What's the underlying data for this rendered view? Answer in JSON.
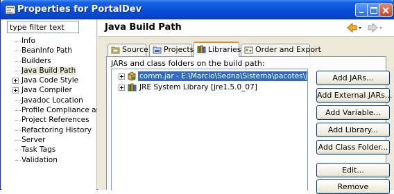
{
  "window": {
    "title": "Properties for PortalDev",
    "minimize_icon": "minimize-icon",
    "maximize_icon": "maximize-icon",
    "close_icon": "close-icon"
  },
  "filter": {
    "value": "type filter text"
  },
  "tree": {
    "items": [
      {
        "label": "Info",
        "expandable": false
      },
      {
        "label": "BeanInfo Path",
        "expandable": false
      },
      {
        "label": "Builders",
        "expandable": false
      },
      {
        "label": "Java Build Path",
        "expandable": false,
        "selected": true
      },
      {
        "label": "Java Code Style",
        "expandable": true
      },
      {
        "label": "Java Compiler",
        "expandable": true
      },
      {
        "label": "Javadoc Location",
        "expandable": false
      },
      {
        "label": "Profile Compliance and Va",
        "expandable": false
      },
      {
        "label": "Project References",
        "expandable": false
      },
      {
        "label": "Refactoring History",
        "expandable": false
      },
      {
        "label": "Server",
        "expandable": false
      },
      {
        "label": "Task Tags",
        "expandable": false
      },
      {
        "label": "Validation",
        "expandable": false
      }
    ]
  },
  "page": {
    "title": "Java Build Path"
  },
  "tabs": [
    {
      "label": "Source",
      "icon": "source-folder-icon"
    },
    {
      "label": "Projects",
      "icon": "projects-icon"
    },
    {
      "label": "Libraries",
      "icon": "libraries-icon",
      "active": true
    },
    {
      "label": "Order and Export",
      "icon": "order-export-icon"
    }
  ],
  "libraries": {
    "description": "JARs and class folders on the build path:",
    "entries": [
      {
        "label": "comm.jar - E:\\Marcio\\Sedna\\Sistema\\pacotes\\javacomm",
        "icon": "jar-icon",
        "selected": true
      },
      {
        "label": "JRE System Library [jre1.5.0_07]",
        "icon": "library-icon",
        "selected": false
      }
    ],
    "buttons": [
      "Add JARs...",
      "Add External JARs...",
      "Add Variable...",
      "Add Library...",
      "Add Class Folder...",
      "Edit...",
      "Remove"
    ]
  },
  "colors": {
    "titlebar": "#0a50d8",
    "selection": "#316ac5",
    "active_tab_accent": "#e68b2c"
  }
}
